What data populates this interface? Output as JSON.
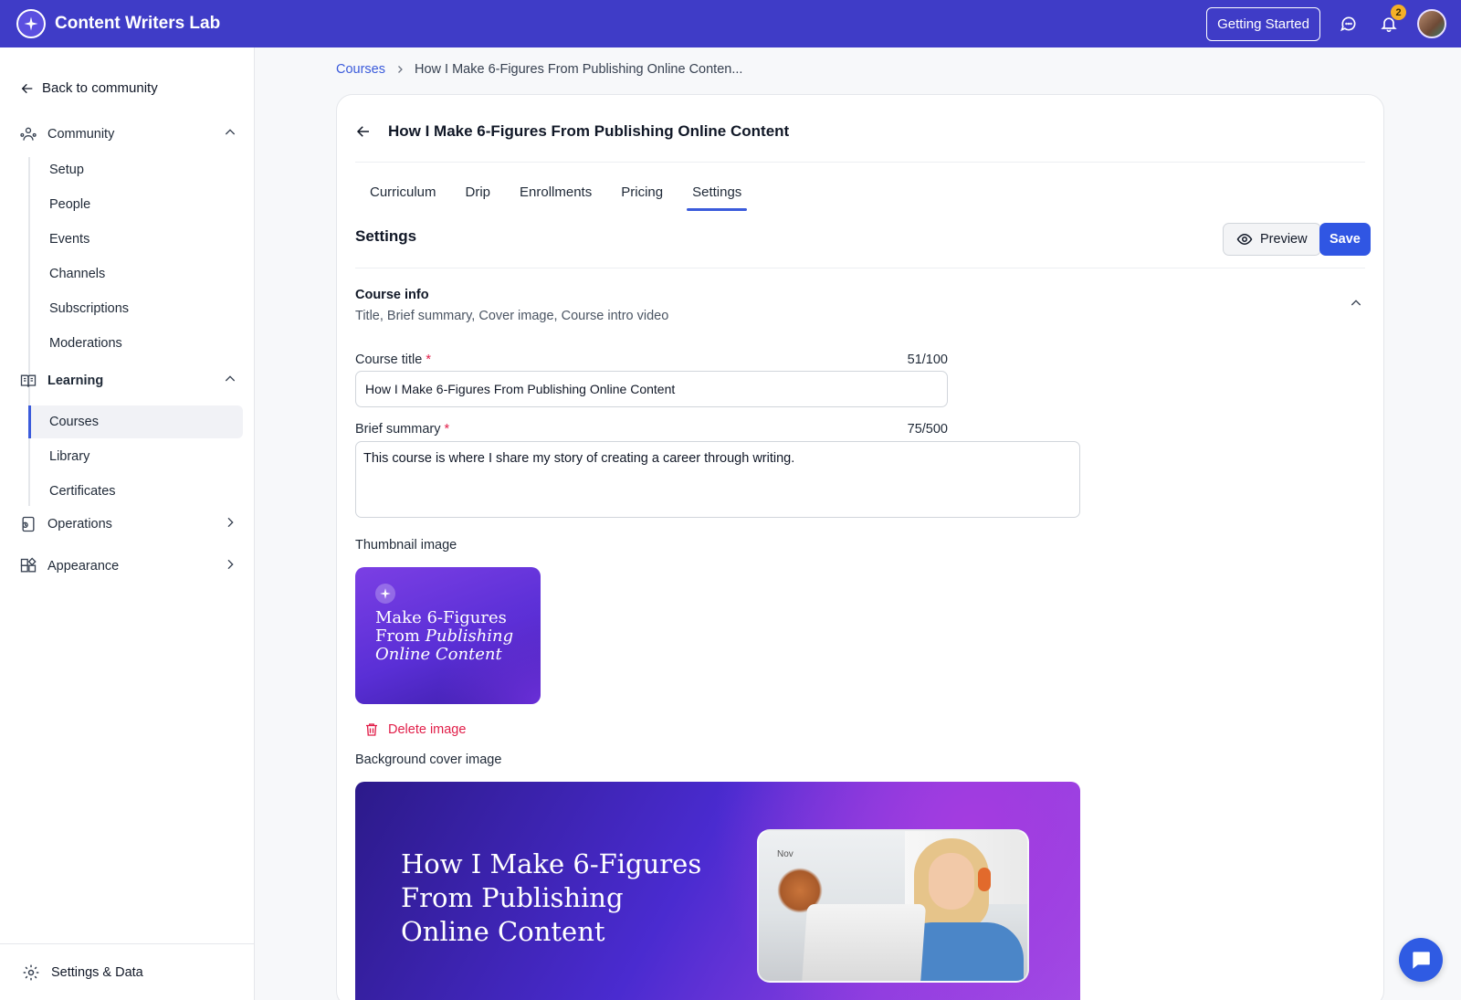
{
  "app": {
    "brand": "Content Writers Lab",
    "getting_started": "Getting Started",
    "notification_count": "2"
  },
  "sidebar": {
    "back_label": "Back to community",
    "community": {
      "label": "Community",
      "items": [
        "Setup",
        "People",
        "Events",
        "Channels",
        "Subscriptions",
        "Moderations"
      ]
    },
    "learning": {
      "label": "Learning",
      "items": [
        "Courses",
        "Library",
        "Certificates"
      ],
      "active": "Courses"
    },
    "operations_label": "Operations",
    "appearance_label": "Appearance",
    "footer_label": "Settings & Data"
  },
  "breadcrumb": {
    "root": "Courses",
    "current": "How I Make 6-Figures From Publishing Online Conten..."
  },
  "course": {
    "title": "How I Make 6-Figures From Publishing Online Content"
  },
  "tabs": [
    {
      "label": "Curriculum"
    },
    {
      "label": "Drip"
    },
    {
      "label": "Enrollments"
    },
    {
      "label": "Pricing"
    },
    {
      "label": "Settings",
      "active": true
    }
  ],
  "settings": {
    "heading": "Settings",
    "preview_label": "Preview",
    "save_label": "Save",
    "section": {
      "title": "Course info",
      "subtitle": "Title, Brief summary, Cover image, Course intro video"
    },
    "course_title": {
      "label": "Course title",
      "required_mark": "*",
      "counter": "51/100",
      "value": "How I Make 6-Figures From Publishing Online Content"
    },
    "brief_summary": {
      "label": "Brief summary",
      "required_mark": "*",
      "counter": "75/500",
      "value": "This course is where I share my story of creating a career through writing."
    },
    "thumbnail": {
      "label": "Thumbnail image",
      "line1": "Make 6-Figures",
      "line2_a": "From ",
      "line2_b": "Publishing",
      "line3": "Online Content"
    },
    "delete_image_label": "Delete image",
    "cover": {
      "label": "Background cover image",
      "title": "How I Make 6-Figures From Publishing Online Content",
      "calendar_text": "Nov"
    }
  },
  "colors": {
    "topbar": "#3f3cc7",
    "accent": "#3b5bdb",
    "save": "#3056e3",
    "annotation": "#e21b1b",
    "danger": "#e11d48"
  },
  "icons": [
    "logo-star-icon",
    "chat-icon",
    "bell-icon",
    "arrow-left-icon",
    "community-icon",
    "book-icon",
    "operations-icon",
    "appearance-icon",
    "chevron-up-icon",
    "chevron-down-icon",
    "chevron-right-icon",
    "gear-icon",
    "eye-icon",
    "trash-icon",
    "chat-bubble-icon"
  ]
}
